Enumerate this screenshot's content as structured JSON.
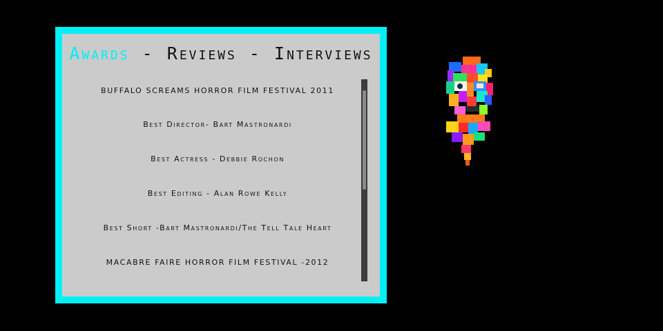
{
  "nav": {
    "awards": "Awards",
    "sep1": " - ",
    "reviews": "Reviews",
    "sep2": " - ",
    "interviews": "Interviews"
  },
  "entries": [
    "BUFFALO SCREAMS HORROR FILM FESTIVAL 2011",
    "Best Director- Bart Mastronardi",
    "Best Actress - Debbie Rochon",
    "Best Editing - Alan Rowe Kelly",
    "Best Short -Bart Mastronardi/The Tell Tale Heart",
    "MACABRE FAIRE HORROR FILM FESTIVAL -2012"
  ],
  "colors": {
    "accent": "#00f0f5",
    "panel_bg": "#cbcbcb",
    "page_bg": "#000000"
  },
  "portrait_icon": "colorful-mosaic-face-portrait"
}
